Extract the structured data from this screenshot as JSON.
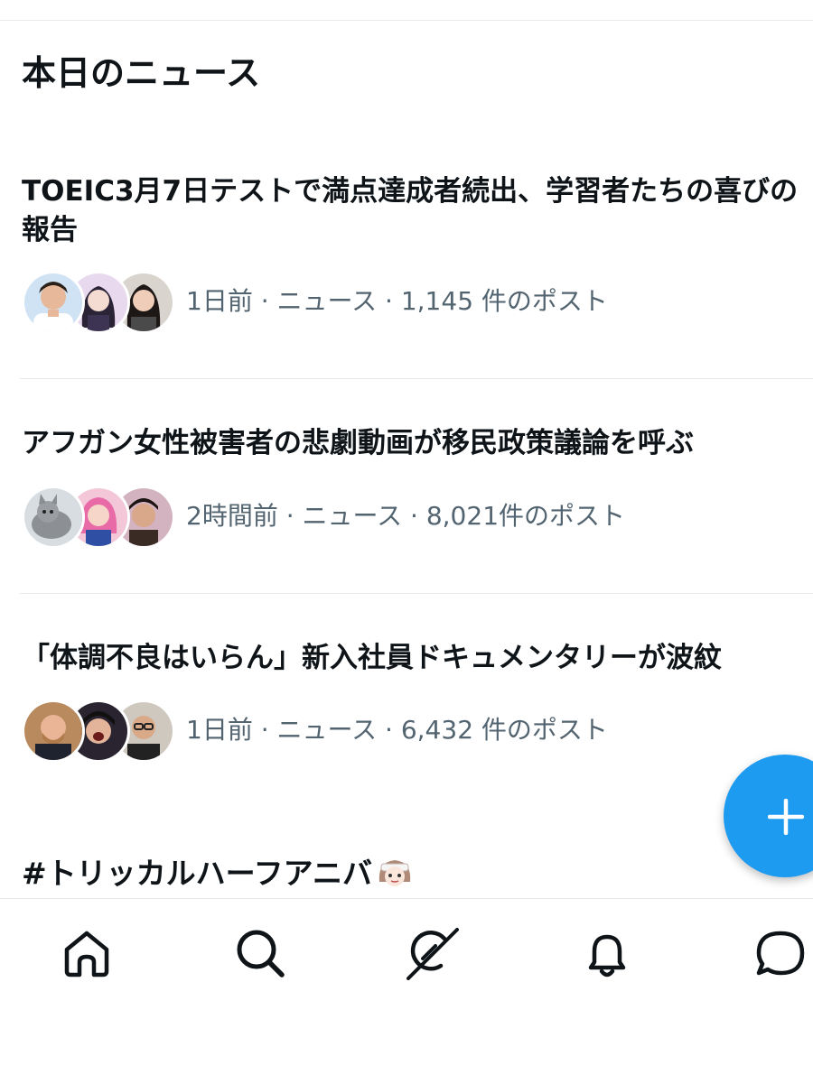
{
  "section": {
    "title": "本日のニュース"
  },
  "news": [
    {
      "headline": "TOEIC3月7日テストで満点達成者続出、学習者たちの喜びの報告",
      "time": "1日前",
      "category": "ニュース",
      "posts": "1,145 件のポスト",
      "separator": " · ",
      "avatars": [
        "man-avatar",
        "anime-girl-avatar",
        "woman-avatar"
      ]
    },
    {
      "headline": "アフガン女性被害者の悲劇動画が移民政策議論を呼ぶ",
      "time": "2時間前",
      "category": "ニュース",
      "posts": "8,021件のポスト",
      "separator": " · ",
      "avatars": [
        "cat-avatar",
        "pink-hair-avatar",
        "man-avatar"
      ]
    },
    {
      "headline": "「体調不良はいらん」新入社員ドキュメンタリーが波紋",
      "time": "1日前",
      "category": "ニュース",
      "posts": "6,432 件のポスト",
      "separator": " · ",
      "avatars": [
        "bald-man-avatar",
        "shouting-man-avatar",
        "glasses-man-avatar"
      ]
    }
  ],
  "trend": {
    "title": "#トリッカルハーフアニバ",
    "emoji": "chibi-character-emoji"
  },
  "fab": {
    "icon": "plus-icon"
  },
  "nav": {
    "items": [
      {
        "icon": "home-icon",
        "label": "home"
      },
      {
        "icon": "search-icon",
        "label": "search"
      },
      {
        "icon": "grok-icon",
        "label": "grok"
      },
      {
        "icon": "bell-icon",
        "label": "notifications"
      },
      {
        "icon": "chat-bubble-icon",
        "label": "messages"
      }
    ]
  },
  "colors": {
    "accent": "#1d9bf0",
    "text": "#0f1419",
    "secondary_text": "#536471",
    "divider": "#e6e8ea"
  }
}
